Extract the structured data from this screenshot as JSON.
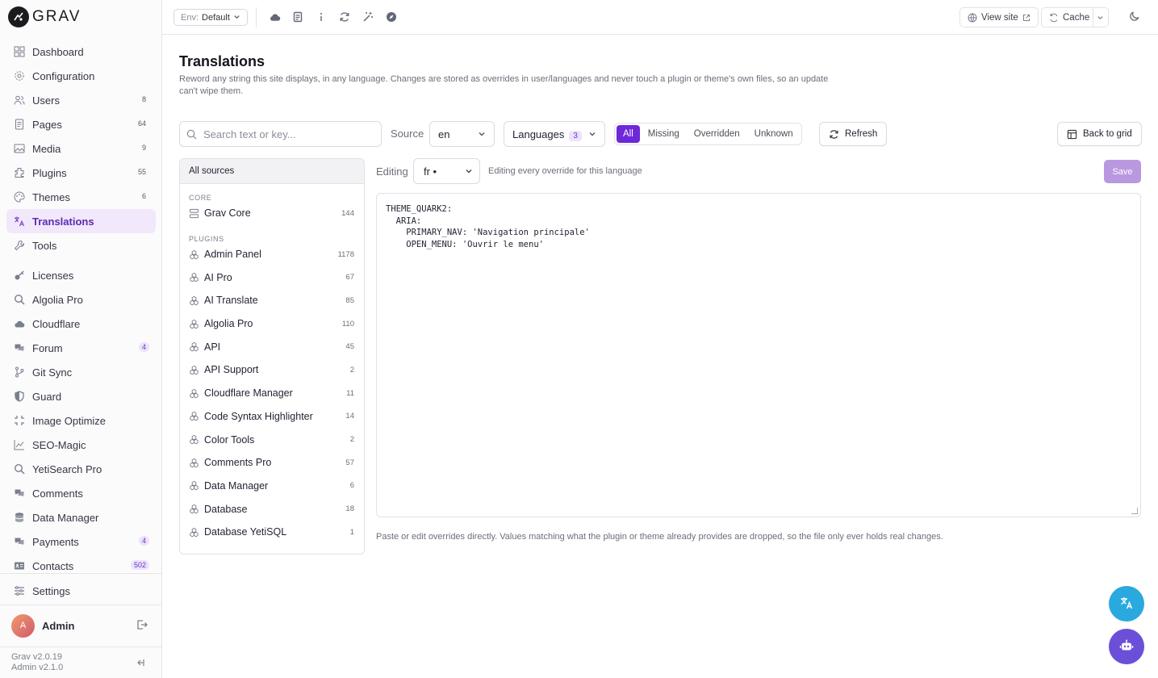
{
  "brand": {
    "name": "GRAV"
  },
  "sidebar": {
    "items": [
      {
        "label": "Dashboard",
        "badge": "",
        "icon": "dashboard-icon"
      },
      {
        "label": "Configuration",
        "badge": "",
        "icon": "gear-icon"
      },
      {
        "label": "Users",
        "badge": "8",
        "icon": "users-icon"
      },
      {
        "label": "Pages",
        "badge": "64",
        "icon": "page-icon"
      },
      {
        "label": "Media",
        "badge": "9",
        "icon": "image-icon"
      },
      {
        "label": "Plugins",
        "badge": "55",
        "icon": "plugin-icon"
      },
      {
        "label": "Themes",
        "badge": "6",
        "icon": "palette-icon"
      },
      {
        "label": "Translations",
        "badge": "",
        "icon": "translate-icon"
      },
      {
        "label": "Tools",
        "badge": "",
        "icon": "wrench-icon"
      }
    ],
    "plugin_items": [
      {
        "label": "Licenses",
        "badge": ""
      },
      {
        "label": "Algolia Pro",
        "badge": ""
      },
      {
        "label": "Cloudflare",
        "badge": ""
      },
      {
        "label": "Forum",
        "badge": "4"
      },
      {
        "label": "Git Sync",
        "badge": ""
      },
      {
        "label": "Guard",
        "badge": ""
      },
      {
        "label": "Image Optimize",
        "badge": ""
      },
      {
        "label": "SEO-Magic",
        "badge": ""
      },
      {
        "label": "YetiSearch Pro",
        "badge": ""
      },
      {
        "label": "Comments",
        "badge": ""
      },
      {
        "label": "Data Manager",
        "badge": ""
      },
      {
        "label": "Payments",
        "badge": "4"
      },
      {
        "label": "Contacts",
        "badge": "502"
      }
    ],
    "settings_label": "Settings",
    "user_initial": "A",
    "user_name": "Admin",
    "version_grav": "Grav v2.0.19",
    "version_admin": "Admin v2.1.0"
  },
  "topbar": {
    "env_label": "Env:",
    "env_value": "Default",
    "view_site": "View site",
    "cache": "Cache"
  },
  "page": {
    "title": "Translations",
    "subtitle": "Reword any string this site displays, in any language. Changes are stored as overrides in user/languages and never touch a plugin or theme's own files, so an update can't wipe them."
  },
  "toolbar": {
    "search_placeholder": "Search text or key...",
    "source_label": "Source",
    "source_value": "en",
    "languages_label": "Languages",
    "languages_count": "3",
    "filters": [
      "All",
      "Missing",
      "Overridden",
      "Unknown"
    ],
    "active_filter": "All",
    "refresh": "Refresh",
    "back_to_grid": "Back to grid"
  },
  "sources": {
    "all_label": "All sources",
    "core_heading": "CORE",
    "core": [
      {
        "name": "Grav Core",
        "count": "144"
      }
    ],
    "plugins_heading": "PLUGINS",
    "plugins": [
      {
        "name": "Admin Panel",
        "count": "1178"
      },
      {
        "name": "AI Pro",
        "count": "67"
      },
      {
        "name": "AI Translate",
        "count": "85"
      },
      {
        "name": "Algolia Pro",
        "count": "110"
      },
      {
        "name": "API",
        "count": "45"
      },
      {
        "name": "API Support",
        "count": "2"
      },
      {
        "name": "Cloudflare Manager",
        "count": "11"
      },
      {
        "name": "Code Syntax Highlighter",
        "count": "14"
      },
      {
        "name": "Color Tools",
        "count": "2"
      },
      {
        "name": "Comments Pro",
        "count": "57"
      },
      {
        "name": "Data Manager",
        "count": "6"
      },
      {
        "name": "Database",
        "count": "18"
      },
      {
        "name": "Database YetiSQL",
        "count": "1"
      }
    ]
  },
  "editor": {
    "editing_label": "Editing",
    "language": "fr •",
    "note": "Editing every override for this language",
    "save": "Save",
    "content": "THEME_QUARK2:\n  ARIA:\n    PRIMARY_NAV: 'Navigation principale'\n    OPEN_MENU: 'Ouvrir le menu'",
    "help": "Paste or edit overrides directly. Values matching what the plugin or theme already provides are dropped, so the file only ever holds real changes."
  },
  "colors": {
    "accent": "#6d28d9",
    "active_bg": "#f1e8fb",
    "save_disabled": "#b998e0",
    "fab_translate": "#2aa9df",
    "fab_bot": "#6b4fd8"
  }
}
